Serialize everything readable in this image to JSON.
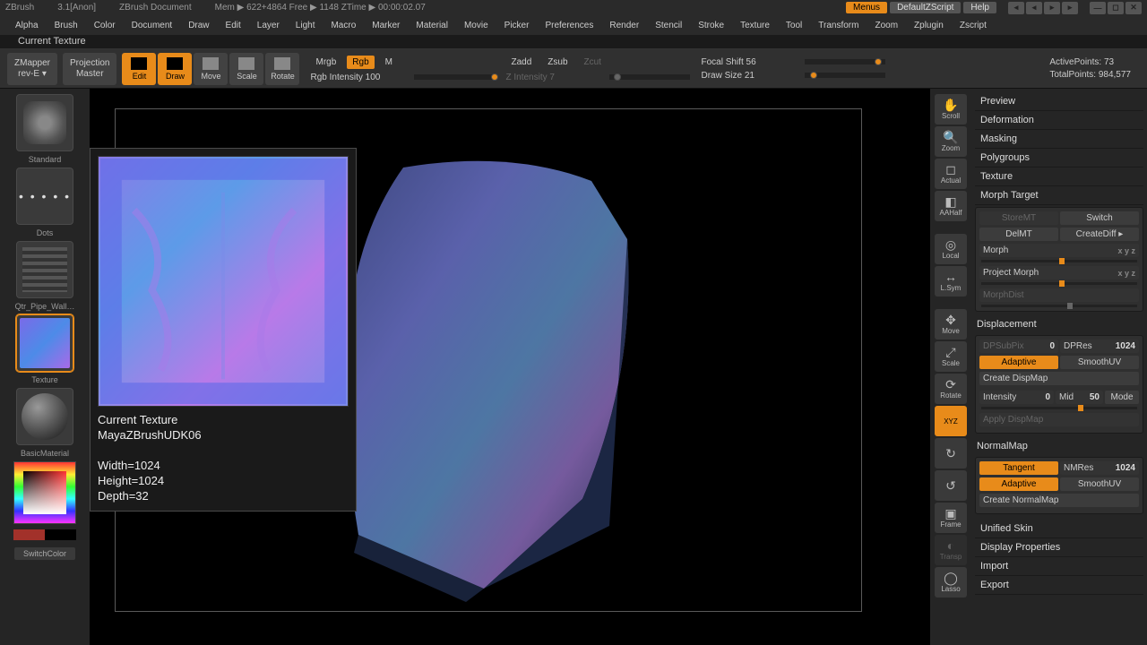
{
  "title": {
    "app": "ZBrush",
    "ver": "3.1[Anon]",
    "doc": "ZBrush Document",
    "mem": "Mem ▶ 622+4864  Free ▶ 1148  ZTime ▶ 00:00:02.07"
  },
  "topbuttons": {
    "menus": "Menus",
    "defscript": "DefaultZScript",
    "help": "Help"
  },
  "menus": [
    "Alpha",
    "Brush",
    "Color",
    "Document",
    "Draw",
    "Edit",
    "Layer",
    "Light",
    "Macro",
    "Marker",
    "Material",
    "Movie",
    "Picker",
    "Preferences",
    "Render",
    "Stencil",
    "Stroke",
    "Texture",
    "Tool",
    "Transform",
    "Zoom",
    "Zplugin",
    "Zscript"
  ],
  "infoline": "Current Texture",
  "toolbar": {
    "zmapper": "ZMapper",
    "zmapper2": "rev-E ▾",
    "projmaster": "Projection",
    "projmaster2": "Master",
    "edit": "Edit",
    "draw": "Draw",
    "move": "Move",
    "scale": "Scale",
    "rotate": "Rotate",
    "mrgb": "Mrgb",
    "rgb": "Rgb",
    "m": "M",
    "zadd": "Zadd",
    "zsub": "Zsub",
    "zcut": "Zcut",
    "rgbint": "Rgb Intensity 100",
    "zint": "Z Intensity 7",
    "focal": "Focal Shift 56",
    "drawsize": "Draw Size 21",
    "active": "ActivePoints: 73",
    "total": "TotalPoints: 984,577"
  },
  "left": {
    "brush": "Standard",
    "stroke": "Dots",
    "alpha": "Qtr_Pipe_Wall…",
    "texture": "Texture",
    "material": "BasicMaterial",
    "switch": "SwitchColor"
  },
  "popup": {
    "title": "Current Texture",
    "name": "MayaZBrushUDK06",
    "w": "Width=1024",
    "h": "Height=1024",
    "d": "Depth=32"
  },
  "sidetools": {
    "scroll": "Scroll",
    "zoom": "Zoom",
    "actual": "Actual",
    "aahalf": "AAHalf",
    "local": "Local",
    "lsym": "L.Sym",
    "move": "Move",
    "scale": "Scale",
    "rotate": "Rotate",
    "xyz": "XYZ",
    "frame": "Frame",
    "transp": "Transp",
    "lasso": "Lasso"
  },
  "right": {
    "preview": "Preview",
    "deformation": "Deformation",
    "masking": "Masking",
    "polygroups": "Polygroups",
    "texture": "Texture",
    "morphtarget": "Morph Target",
    "storemt": "StoreMT",
    "switch": "Switch",
    "delmt": "DelMT",
    "creatediff": "CreateDiff ▸",
    "morph": "Morph",
    "morph_axes": "x y z",
    "projmorph": "Project Morph",
    "morphdist": "MorphDist",
    "displacement": "Displacement",
    "dpsubpix": "DPSubPix",
    "dpsubpix_v": "0",
    "dpres": "DPRes",
    "dpres_v": "1024",
    "adaptive": "Adaptive",
    "smoothuv": "SmoothUV",
    "createdisp": "Create DispMap",
    "intensity": "Intensity",
    "intensity_v": "0",
    "mid": "Mid",
    "mid_v": "50",
    "mode": "Mode",
    "applydisp": "Apply DispMap",
    "normalmap": "NormalMap",
    "tangent": "Tangent",
    "nmres": "NMRes",
    "nmres_v": "1024",
    "createnm": "Create NormalMap",
    "unified": "Unified Skin",
    "dispprops": "Display Properties",
    "import": "Import",
    "export": "Export"
  },
  "chart_data": null
}
